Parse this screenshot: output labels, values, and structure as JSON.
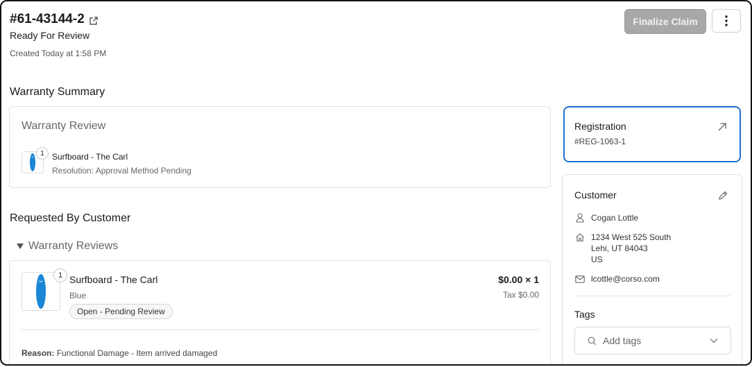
{
  "header": {
    "claim_id": "#61-43144-2",
    "status": "Ready For Review",
    "created": "Created Today at 1:58 PM",
    "finalize_label": "Finalize Claim"
  },
  "warranty_summary": {
    "title": "Warranty Summary",
    "card_title": "Warranty Review",
    "item": {
      "name": "Surfboard - The Carl",
      "resolution": "Resolution: Approval Method Pending",
      "quantity": "1"
    }
  },
  "requested": {
    "title": "Requested By Customer",
    "group_title": "Warranty Reviews",
    "item": {
      "name": "Surfboard - The Carl",
      "variant": "Blue",
      "quantity": "1",
      "price": "$0.00 × 1",
      "tax": "Tax $0.00",
      "status_pill": "Open - Pending Review"
    },
    "reason_label": "Reason:",
    "reason_value": "Functional Damage - Item arrived damaged"
  },
  "registration": {
    "title": "Registration",
    "id": "#REG-1063-1"
  },
  "customer": {
    "title": "Customer",
    "name": "Cogan Lottle",
    "address_line1": "1234 West 525 South",
    "address_line2": "Lehi, UT 84043",
    "address_line3": "US",
    "email": "lcottle@corso.com"
  },
  "tags": {
    "title": "Tags",
    "placeholder": "Add tags"
  },
  "colors": {
    "accent_blue": "#1f6fd1",
    "surfboard_blue": "#1a86d6",
    "disabled_button": "#a8a8a8"
  }
}
